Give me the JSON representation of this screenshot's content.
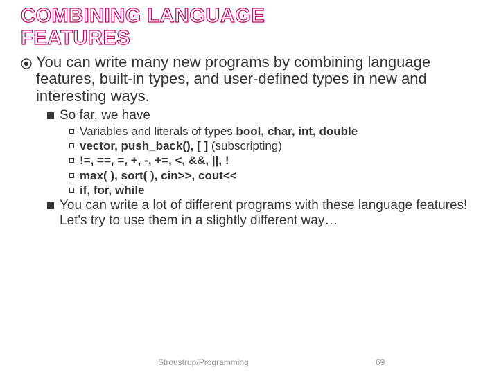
{
  "title_line1": "COMBINING LANGUAGE",
  "title_line2": "FEATURES",
  "body": {
    "p1": "You can write many new programs by combining language features, built-in types, and user-defined types in new and interesting ways.",
    "sub1": "So far, we have",
    "items": [
      {
        "pre": "Variables and literals of types ",
        "bold": "bool, char, int, double"
      },
      {
        "bold": "vector, push_back(), [ ] ",
        "post": "(subscripting)"
      },
      {
        "bold": "!=, ==, =, +, -, +=, <, &&, ||, !"
      },
      {
        "bold": "max( ), sort( ), cin>>, cout<<"
      },
      {
        "bold": "if, for, while"
      }
    ],
    "sub2": "You can write a lot of different programs with these language features! Let's try to use them in a slightly different way…"
  },
  "footer": {
    "source": "Stroustrup/Programming",
    "page": "69"
  }
}
